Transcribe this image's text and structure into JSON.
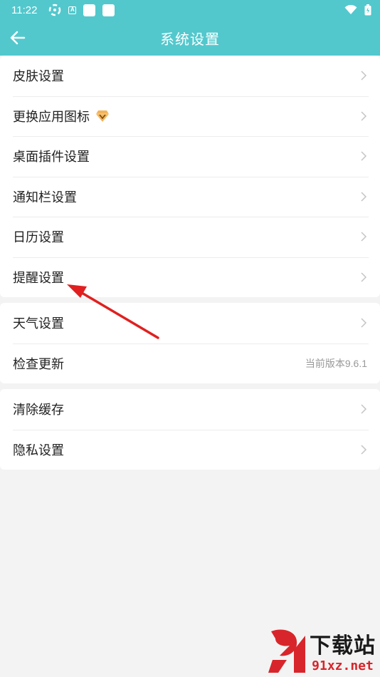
{
  "status_bar": {
    "time": "11:22",
    "icons": [
      "sync-icon",
      "a-notification-icon",
      "app-square-icon",
      "app-square-icon",
      "wifi-icon",
      "battery-icon"
    ]
  },
  "header": {
    "title": "系统设置",
    "back_icon": "arrow-left-icon"
  },
  "groups": [
    {
      "items": [
        {
          "label": "皮肤设置"
        },
        {
          "label": "更换应用图标",
          "badge_icon": "vip-diamond-icon"
        },
        {
          "label": "桌面插件设置"
        },
        {
          "label": "通知栏设置"
        },
        {
          "label": "日历设置"
        },
        {
          "label": "提醒设置"
        }
      ]
    },
    {
      "items": [
        {
          "label": "天气设置"
        },
        {
          "label": "检查更新",
          "value": "当前版本9.6.1"
        }
      ]
    },
    {
      "items": [
        {
          "label": "清除缓存"
        },
        {
          "label": "隐私设置"
        }
      ]
    }
  ],
  "annotation_color": "#e02020",
  "colors": {
    "accent": "#52c8cd",
    "background": "#f3f3f3"
  },
  "watermark": {
    "cn": "下载站",
    "url": "91xz.net"
  }
}
